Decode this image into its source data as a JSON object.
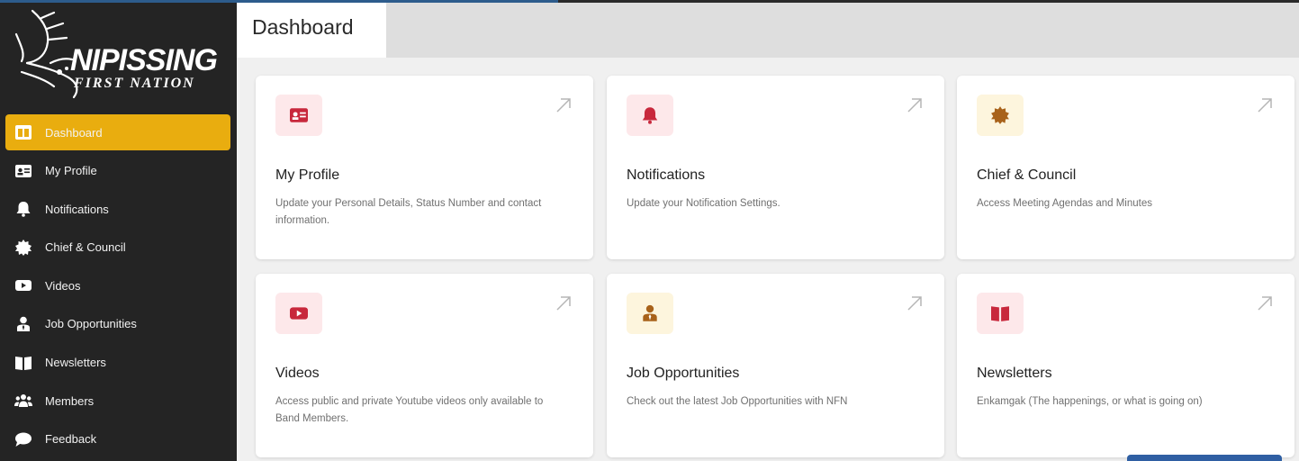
{
  "brand": {
    "name": "NIPISSING",
    "subname": "FIRST NATION"
  },
  "sidebar": {
    "items": [
      {
        "label": "Dashboard",
        "icon": "dashboard-icon",
        "active": true
      },
      {
        "label": "My Profile",
        "icon": "id-card-icon"
      },
      {
        "label": "Notifications",
        "icon": "bell-icon"
      },
      {
        "label": "Chief & Council",
        "icon": "badge-icon"
      },
      {
        "label": "Videos",
        "icon": "youtube-icon"
      },
      {
        "label": "Job Opportunities",
        "icon": "user-tie-icon"
      },
      {
        "label": "Newsletters",
        "icon": "book-icon"
      },
      {
        "label": "Members",
        "icon": "users-icon"
      },
      {
        "label": "Feedback",
        "icon": "comment-icon"
      }
    ]
  },
  "header": {
    "tab_label": "Dashboard"
  },
  "cards": [
    {
      "title": "My Profile",
      "description": "Update your Personal Details, Status Number and contact information.",
      "icon": "id-card-icon",
      "icon_color": "#c8283c",
      "icon_bg": "#fde8ea"
    },
    {
      "title": "Notifications",
      "description": "Update your Notification Settings.",
      "icon": "bell-icon",
      "icon_color": "#c8283c",
      "icon_bg": "#fde8ea"
    },
    {
      "title": "Chief & Council",
      "description": "Access Meeting Agendas and Minutes",
      "icon": "badge-icon",
      "icon_color": "#a8621a",
      "icon_bg": "#fdf5dd"
    },
    {
      "title": "Videos",
      "description": "Access public and private Youtube videos only available to Band Members.",
      "icon": "youtube-icon",
      "icon_color": "#c8283c",
      "icon_bg": "#fde8ea"
    },
    {
      "title": "Job Opportunities",
      "description": "Check out the latest Job Opportunities with NFN",
      "icon": "user-tie-icon",
      "icon_color": "#a8621a",
      "icon_bg": "#fdf5dd"
    },
    {
      "title": "Newsletters",
      "description": "Enkamgak (The happenings, or what is going on)",
      "icon": "book-icon",
      "icon_color": "#c8283c",
      "icon_bg": "#fde8ea"
    }
  ],
  "colors": {
    "sidebar_bg": "#242424",
    "active_bg": "#e9ad0f",
    "accent_blue": "#2f5fa3"
  }
}
